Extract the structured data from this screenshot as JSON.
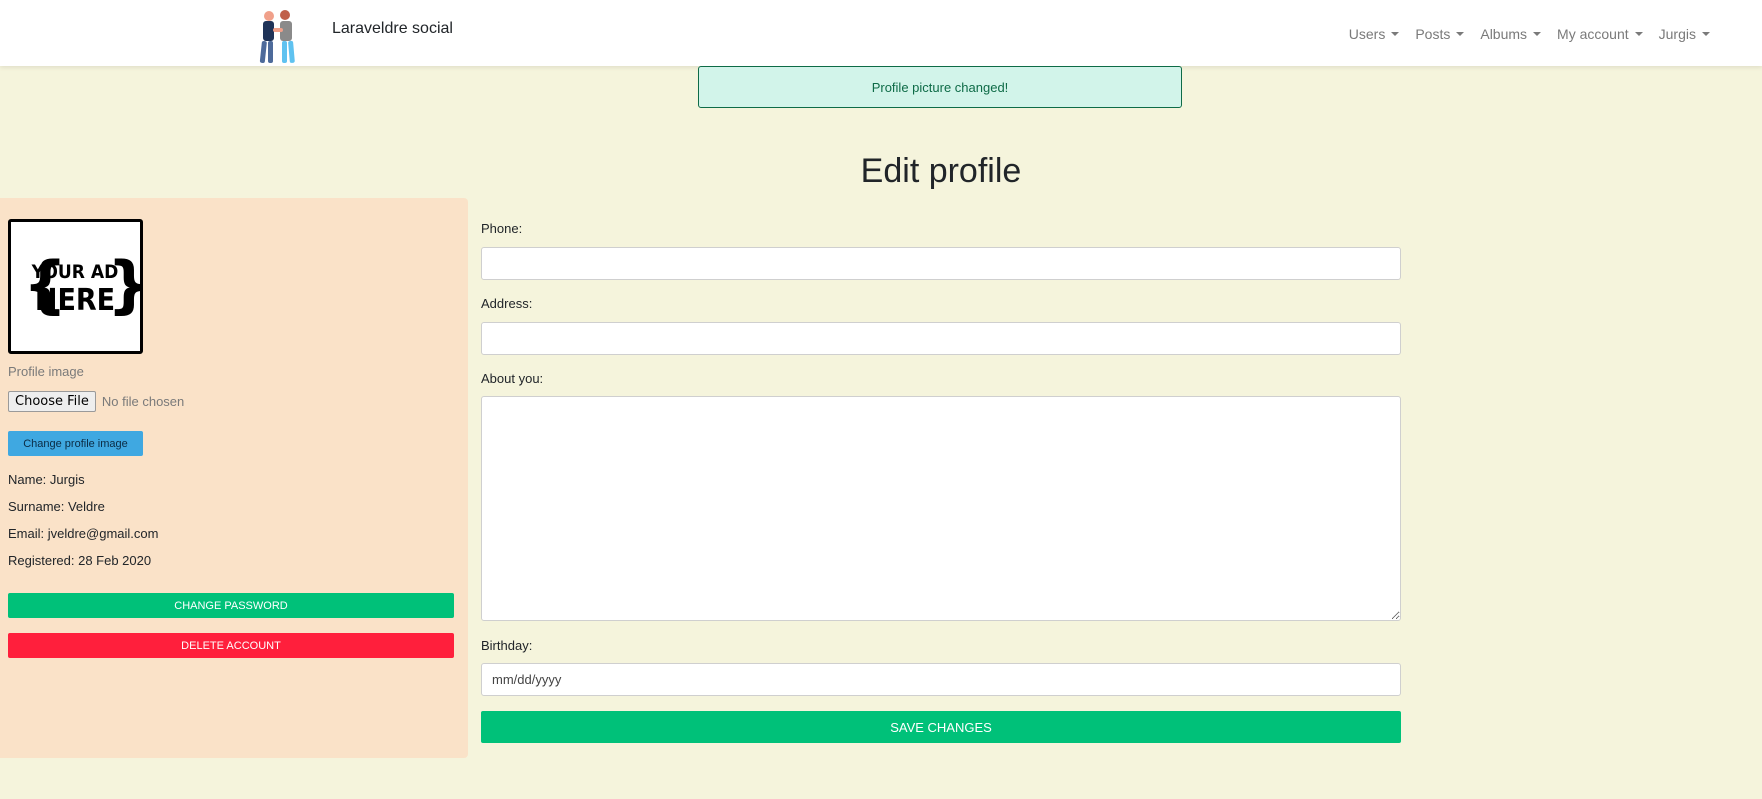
{
  "navbar": {
    "brand": "Laraveldre social",
    "logo_icon": "people-handshake-logo",
    "menu": [
      {
        "label": "Users"
      },
      {
        "label": "Posts"
      },
      {
        "label": "Albums"
      },
      {
        "label": "My account"
      },
      {
        "label": "Jurgis"
      }
    ]
  },
  "alert": {
    "message": "Profile picture changed!",
    "status_color": "#0e6b47"
  },
  "page": {
    "title": "Edit profile"
  },
  "sidebar": {
    "profile_image_text": [
      "YOUR AD",
      "HERE"
    ],
    "profile_image_label": "Profile image",
    "file_input": {
      "button_label": "Choose File",
      "status": "No file chosen"
    },
    "change_image_label": "Change profile image",
    "info": {
      "name": "Name: Jurgis",
      "surname": "Surname: Veldre",
      "email": "Email: jveldre@gmail.com",
      "registered": "Registered: 28 Feb 2020"
    },
    "change_password_label": "Change password",
    "delete_account_label": "Delete account"
  },
  "form": {
    "phone_label": "Phone:",
    "phone_value": "",
    "address_label": "Address:",
    "address_value": "",
    "about_label": "About you:",
    "about_value": "",
    "birthday_label": "Birthday:",
    "birthday_placeholder": "mm/dd/yyyy",
    "save_label": "Save changes"
  },
  "colors": {
    "page_bg": "#f5f4dc",
    "sidebar_bg": "#fae2c8",
    "primary_green": "#00c179",
    "danger_red": "#ff1f3c",
    "info_blue": "#3fa8e1"
  }
}
